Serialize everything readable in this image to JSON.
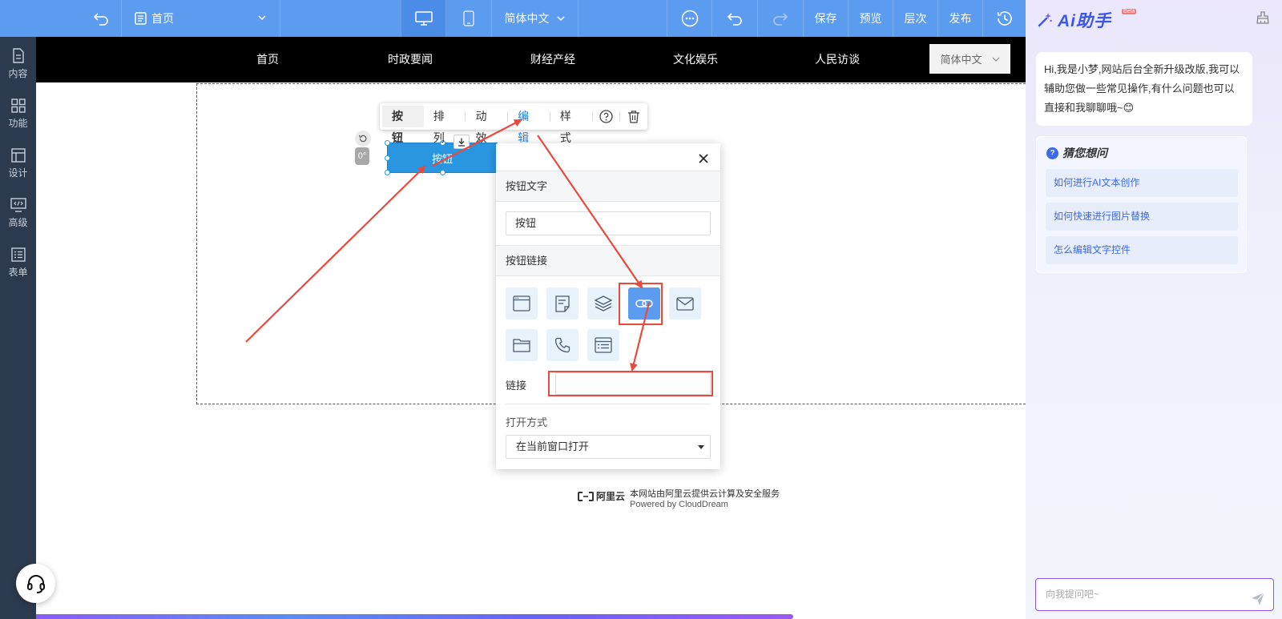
{
  "topbar": {
    "page_label": "首页",
    "language": "简体中文",
    "save": "保存",
    "preview": "预览",
    "layers": "层次",
    "publish": "发布"
  },
  "sidebar": {
    "items": [
      {
        "label": "内容",
        "icon": "document-icon"
      },
      {
        "label": "功能",
        "icon": "grid-icon"
      },
      {
        "label": "设计",
        "icon": "layout-icon"
      },
      {
        "label": "高级",
        "icon": "code-monitor-icon"
      },
      {
        "label": "表单",
        "icon": "form-list-icon"
      }
    ]
  },
  "site_nav": {
    "items": [
      "首页",
      "时政要闻",
      "财经产经",
      "文化娱乐",
      "人民访谈"
    ],
    "language": "简体中文"
  },
  "element_toolbar": {
    "type": "按钮",
    "tabs": [
      "排列",
      "动效",
      "编辑",
      "样式"
    ],
    "active_tab": "编辑"
  },
  "selected_element": {
    "label": "按钮",
    "angle": "0°"
  },
  "edit_panel": {
    "text_section": "按钮文字",
    "text_value": "按钮",
    "link_section": "按钮链接",
    "link_types": [
      "page-icon",
      "article-icon",
      "layers-icon",
      "link-icon",
      "mail-icon",
      "folder-icon",
      "phone-icon",
      "list-icon"
    ],
    "selected_link_type": "link-icon",
    "link_label": "链接",
    "link_value": "",
    "open_mode_label": "打开方式",
    "open_mode_value": "在当前窗口打开"
  },
  "footer": {
    "brand": "阿里云",
    "line1": "本网站由阿里云提供云计算及安全服务",
    "line2": "Powered by CloudDream"
  },
  "ai_assistant": {
    "title": "Ai助手",
    "badge": "Beta",
    "greeting": "Hi,我是小梦,网站后台全新升级改版,我可以辅助您做一些常见操作,有什么问题也可以直接和我聊聊哦~",
    "greeting_emoji": "😊",
    "faq_title": "猜您想问",
    "faq": [
      "如何进行AI文本创作",
      "如何快速进行图片替换",
      "怎么编辑文字控件"
    ],
    "input_placeholder": "向我提问吧~"
  },
  "colors": {
    "topbar": "#5b9cf0",
    "sidebar": "#2c3a4e",
    "accent": "#1e82e6",
    "annotation": "#e84a3e"
  }
}
